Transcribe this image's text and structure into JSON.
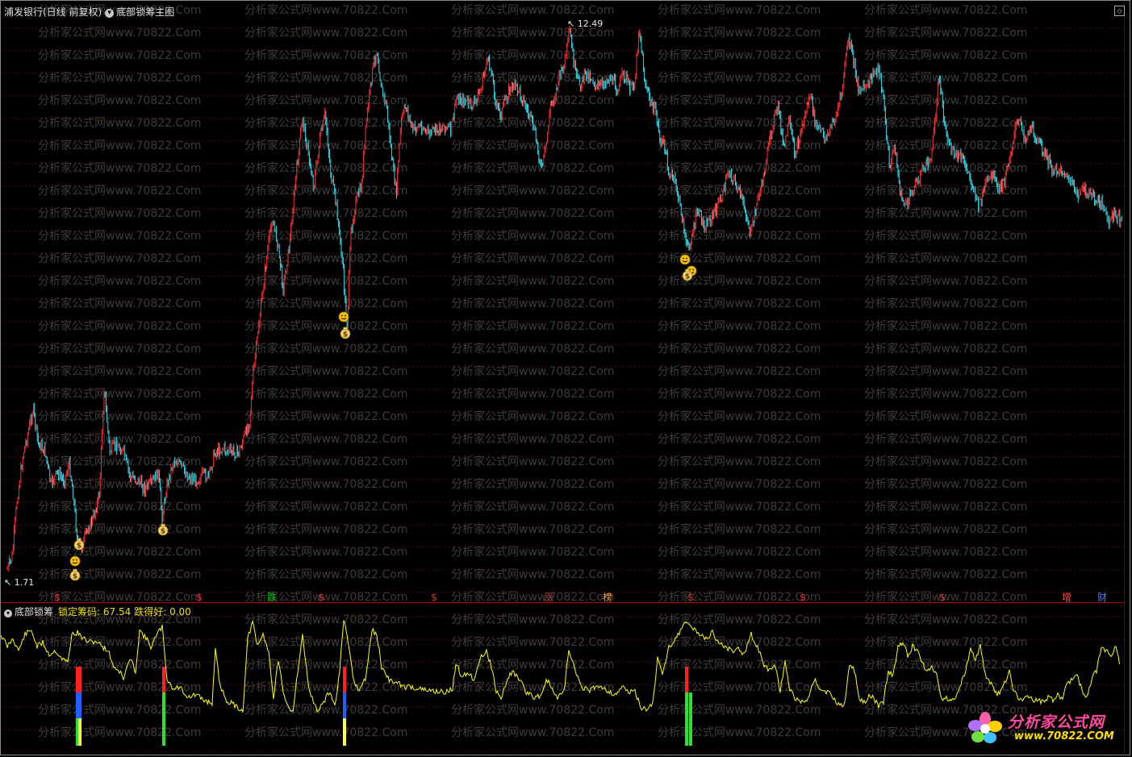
{
  "header": {
    "stock_title": "浦发银行(日线 前复权)",
    "indicator_title": "底部锁筹主图",
    "corner_icon": "window-control-icon"
  },
  "price_labels": {
    "high": "12.49",
    "low": "1.71"
  },
  "sub_panel": {
    "title": "底部锁筹",
    "lock_label": "锁定筹码: 67.54",
    "good_label": "跌得好: 0.00"
  },
  "watermark": "分析家公式网www.70822.Com",
  "signal_marks": [
    {
      "label": "$",
      "color": "#e03030"
    },
    {
      "label": "$",
      "color": "#e03030"
    },
    {
      "label": "跌",
      "color": "#00c000"
    },
    {
      "label": "$",
      "color": "#e03030"
    },
    {
      "label": "$",
      "color": "#e03030"
    },
    {
      "label": "涨",
      "color": "#e03030"
    },
    {
      "label": "榜",
      "color": "#ff9a40"
    },
    {
      "label": "$",
      "color": "#e03030"
    },
    {
      "label": "$",
      "color": "#e03030"
    },
    {
      "label": "$",
      "color": "#e03030"
    },
    {
      "label": "增",
      "color": "#ff5050"
    },
    {
      "label": "财",
      "color": "#4080ff"
    }
  ],
  "logo": {
    "text1": "分析家公式网",
    "text2": "www.70822.COM"
  },
  "colors": {
    "up": "#ff3030",
    "down": "#30e0f0",
    "indicator_line": "#ffff00",
    "grid": "#5a0000"
  }
}
